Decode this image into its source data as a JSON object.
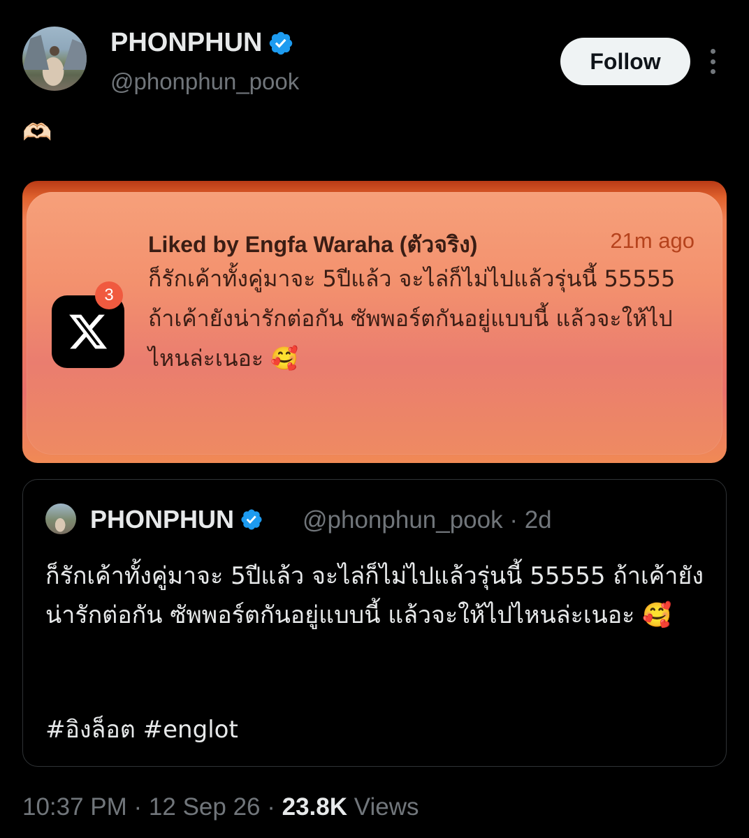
{
  "author": {
    "name": "PHONPHUN",
    "handle": "@phonphun_pook"
  },
  "follow_label": "Follow",
  "tweet_text": "🫶🏻",
  "notification": {
    "title": "Liked by Engfa Waraha (ตัวจริง)",
    "time": "21m ago",
    "badge_count": "3",
    "body": "ก็รักเค้าทั้งคู่มาจะ 5ปีแล้ว จะไล่ก็ไม่ไปแล้วรุ่นนี้ 55555 ถ้าเค้ายังน่ารักต่อกัน ซัพพอร์ตกันอยู่แบบนี้ แล้วจะให้ไปไหนล่ะเนอะ 🥰"
  },
  "quoted_tweet": {
    "name": "PHONPHUN",
    "handle_time": "@phonphun_pook · 2d",
    "body": "ก็รักเค้าทั้งคู่มาจะ 5ปีแล้ว จะไล่ก็ไม่ไปแล้วรุ่นนี้ 55555 ถ้าเค้ายังน่ารักต่อกัน ซัพพอร์ตกันอยู่แบบนี้ แล้วจะให้ไปไหนล่ะเนอะ 🥰",
    "hashtags": "#อิงล็อต #englot"
  },
  "meta": {
    "time_date": "10:37 PM · 12 Sep 26 · ",
    "views_count": "23.8K",
    "views_label": " Views"
  },
  "colors": {
    "verified": "#1d9bf0",
    "muted": "#71767b",
    "text": "#e7e9ea"
  }
}
